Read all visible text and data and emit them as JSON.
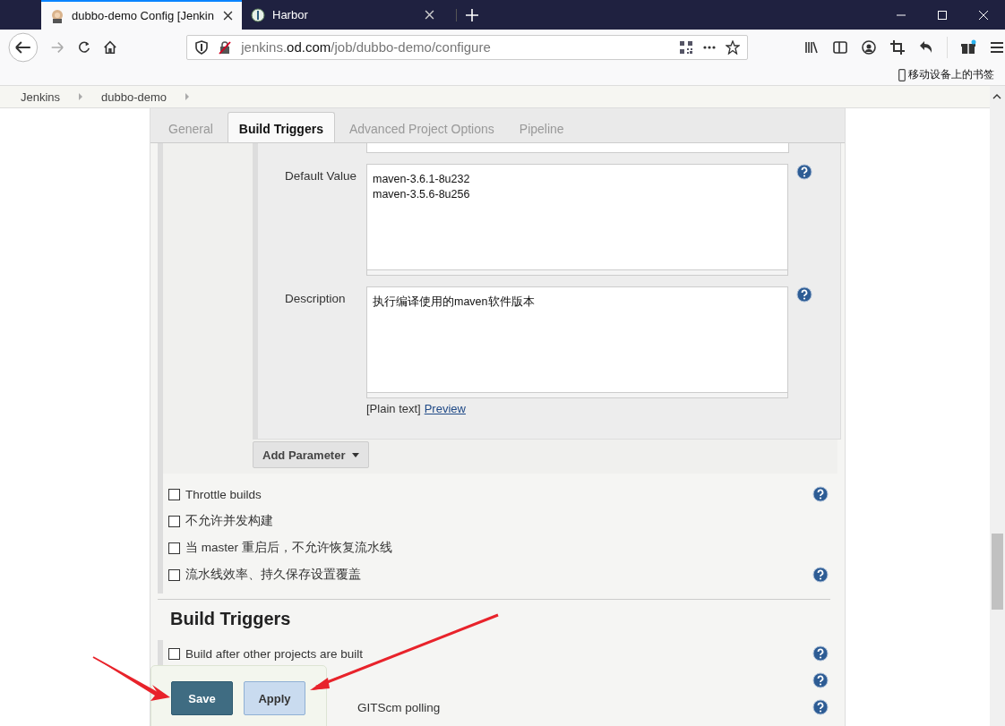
{
  "browser": {
    "tabs": [
      {
        "title": "dubbo-demo Config [Jenkin",
        "selected": true
      },
      {
        "title": "Harbor",
        "selected": false
      }
    ],
    "url": {
      "host": "jenkins.",
      "domain": "od.com",
      "path": "/job/dubbo-demo/configure"
    },
    "bookmark": "移动设备上的书签"
  },
  "breadcrumb": [
    "Jenkins",
    "dubbo-demo"
  ],
  "config_tabs": [
    {
      "label": "General",
      "selected": false
    },
    {
      "label": "Build Triggers",
      "selected": true
    },
    {
      "label": "Advanced Project Options",
      "selected": false
    },
    {
      "label": "Pipeline",
      "selected": false
    }
  ],
  "parameter": {
    "fields": [
      {
        "label": "Default Value",
        "value": "maven-3.6.1-8u232\nmaven-3.5.6-8u256"
      },
      {
        "label": "Description",
        "value": "执行编译使用的maven软件版本"
      }
    ],
    "format_note": "[Plain text]",
    "preview_link": "Preview"
  },
  "add_parameter": "Add Parameter",
  "options": [
    {
      "label": "Throttle builds",
      "checked": false,
      "help": true
    },
    {
      "label": "不允许并发构建",
      "checked": false,
      "help": false
    },
    {
      "label": "当 master 重启后，不允许恢复流水线",
      "checked": false,
      "help": false
    },
    {
      "label": "流水线效率、持久保存设置覆盖",
      "checked": false,
      "help": true
    }
  ],
  "build_triggers": {
    "title": "Build Triggers",
    "items": [
      {
        "kind": "plain",
        "label": "Build after other projects are built",
        "checked": false
      },
      {
        "kind": "covered"
      },
      {
        "kind": "covered",
        "label": "GITScm polling"
      }
    ]
  },
  "actions": [
    {
      "label": "Save",
      "kind": "primary"
    },
    {
      "label": "Apply",
      "kind": "secondary"
    }
  ]
}
